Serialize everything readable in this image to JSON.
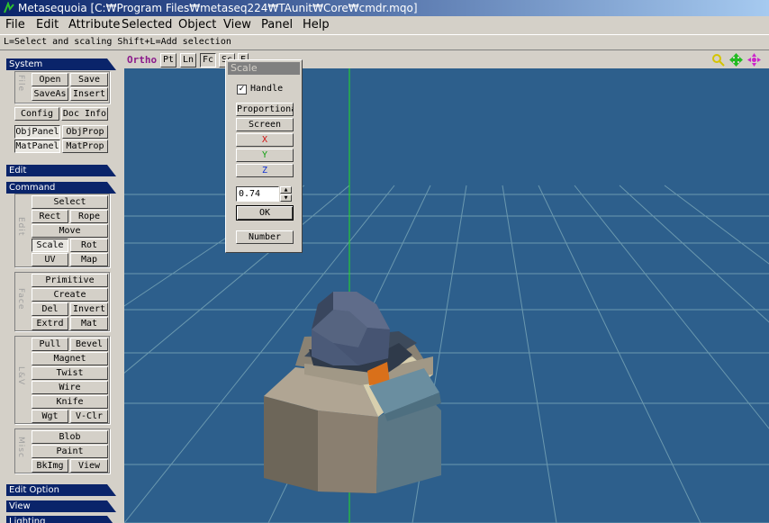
{
  "window": {
    "title": "Metasequoia [C:₩Program Files₩metaseq224₩TAunit₩Core₩cmdr.mqo]"
  },
  "menu": [
    "File",
    "Edit",
    "Attribute",
    "Selected",
    "Object",
    "View",
    "Panel",
    "Help"
  ],
  "status": "L=Select and scaling  Shift+L=Add selection",
  "panel": {
    "system": "System",
    "file_label": "File",
    "open": "Open",
    "save": "Save",
    "saveas": "SaveAs",
    "insert": "Insert",
    "config": "Config",
    "docinfo": "Doc Info",
    "objpanel": "ObjPanel",
    "objprop": "ObjProp",
    "matpanel": "MatPanel",
    "matprop": "MatProp",
    "edit": "Edit",
    "command": "Command",
    "edit_label": "Edit",
    "select": "Select",
    "rect": "Rect",
    "rope": "Rope",
    "move": "Move",
    "scale": "Scale",
    "rot": "Rot",
    "uv": "UV",
    "map": "Map",
    "face_label": "Face",
    "primitive": "Primitive",
    "create": "Create",
    "del": "Del",
    "invert": "Invert",
    "extrd": "Extrd",
    "mat": "Mat",
    "lv_label": "L&V",
    "pull": "Pull",
    "bevel": "Bevel",
    "magnet": "Magnet",
    "twist": "Twist",
    "wire": "Wire",
    "knife": "Knife",
    "wgt": "Wgt",
    "vclr": "V-Clr",
    "misc_label": "Misc",
    "blob": "Blob",
    "paint": "Paint",
    "bkimg": "BkImg",
    "view": "View",
    "edit_option": "Edit Option",
    "view_sec": "View",
    "lighting": "Lighting"
  },
  "viewport": {
    "mode": "Ortho",
    "buttons": [
      "Pt",
      "Ln",
      "Fc",
      "Sc",
      "E"
    ],
    "icons": [
      "zoom-icon",
      "pan-icon",
      "rotate-icon"
    ]
  },
  "scale_dialog": {
    "title": "Scale",
    "handle_label": "Handle",
    "handle_checked": "✓",
    "proportional": "Proportional",
    "screen": "Screen",
    "x": "X",
    "y": "Y",
    "z": "Z",
    "value": "0.74",
    "ok": "OK",
    "number": "Number"
  },
  "colors": {
    "viewport_bg": "#2d5f8c",
    "grid": "#7aa7b8",
    "axis": "#22dd22",
    "title_bar": "#0a246a"
  }
}
